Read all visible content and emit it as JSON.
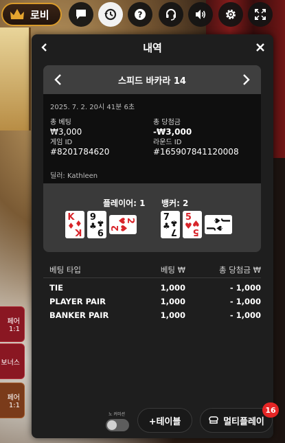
{
  "topbar": {
    "lobby_label": "로비",
    "icons": [
      "chat-icon",
      "history-icon",
      "help-icon",
      "headset-icon",
      "sound-icon",
      "settings-icon",
      "fullscreen-icon"
    ]
  },
  "panel": {
    "title": "내역",
    "game_name": "스피드 바카라 14",
    "date": "2025. 7. 2. 20시 41분 6초",
    "total_bet_label": "총 베팅",
    "total_bet_value": "₩3,000",
    "total_win_label": "총 당첨금",
    "total_win_value": "-₩3,000",
    "game_id_label": "게임 ID",
    "game_id_value": "#8201784620",
    "round_id_label": "라운드 ID",
    "round_id_value": "#165907841120008",
    "dealer": "딜러: Kathleen"
  },
  "result": {
    "player_label": "플레이어: 1",
    "banker_label": "뱅커: 2",
    "player_cards": [
      {
        "rank": "K",
        "suit": "♦",
        "color": "red"
      },
      {
        "rank": "9",
        "suit": "♣",
        "color": "black"
      },
      {
        "rank": "2",
        "suit": "♥",
        "color": "red"
      }
    ],
    "banker_cards": [
      {
        "rank": "7",
        "suit": "♣",
        "color": "black"
      },
      {
        "rank": "5",
        "suit": "♥",
        "color": "red"
      },
      {
        "rank": "J",
        "suit": "♠",
        "color": "black"
      }
    ]
  },
  "bets": {
    "headers": [
      "베팅 타입",
      "베팅 ₩",
      "총 당첨금 ₩"
    ],
    "rows": [
      [
        "TIE",
        "1,000",
        "- 1,000"
      ],
      [
        "PLAYER PAIR",
        "1,000",
        "- 1,000"
      ],
      [
        "BANKER PAIR",
        "1,000",
        "- 1,000"
      ]
    ]
  },
  "side_buttons": [
    "페어\n1:1",
    "보너스",
    "페어\n1:1"
  ],
  "bottom": {
    "toggle_label": "노 커미션",
    "add_table": "+테이블",
    "multiplay": "멀티플레이",
    "badge": "16"
  },
  "colors": {
    "accent": "#d99b2b",
    "badge": "#e52525",
    "panel": "#1e1e1e"
  }
}
